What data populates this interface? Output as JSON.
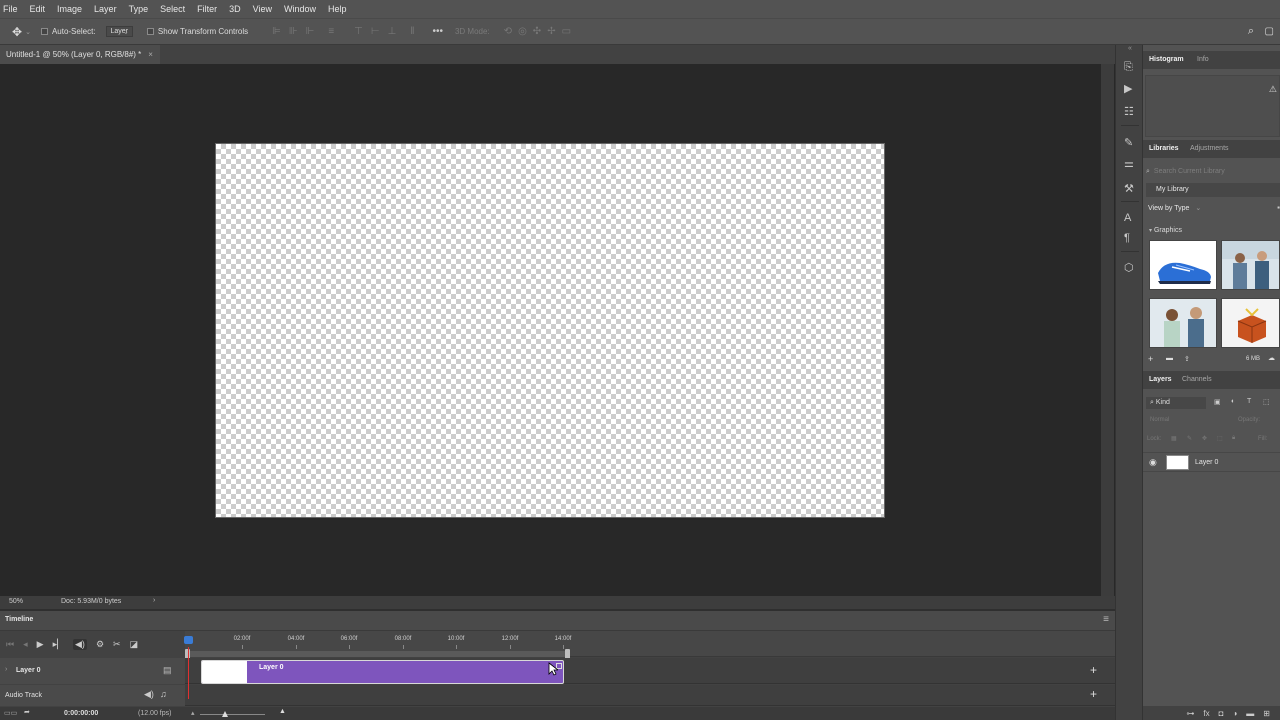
{
  "menu": [
    "File",
    "Edit",
    "Image",
    "Layer",
    "Type",
    "Select",
    "Filter",
    "3D",
    "View",
    "Window",
    "Help"
  ],
  "options": {
    "auto_select_label": "Auto-Select:",
    "auto_select_value": "Layer",
    "show_transform_label": "Show Transform Controls",
    "mode_3d_label": "3D Mode:"
  },
  "document": {
    "tab_title": "Untitled-1 @ 50% (Layer 0, RGB/8#) *",
    "close": "×"
  },
  "status": {
    "zoom": "50%",
    "doc_size": "Doc: 5.93M/0 bytes"
  },
  "timeline": {
    "title": "Timeline",
    "ruler": [
      "02:00f",
      "04:00f",
      "06:00f",
      "08:00f",
      "10:00f",
      "12:00f",
      "14:00f"
    ],
    "layer_track": "Layer 0",
    "clip_label": "Layer 0",
    "audio_track": "Audio Track",
    "timecode": "0:00:00:00",
    "fps": "(12.00 fps)"
  },
  "panels": {
    "histogram_tab": "Histogram",
    "info_tab": "Info",
    "libraries_tab": "Libraries",
    "adjustments_tab": "Adjustments",
    "search_placeholder": "Search Current Library",
    "library_name": "My Library",
    "view_by": "View by Type",
    "graphics_label": "Graphics",
    "library_size": "6 MB",
    "layers_tab": "Layers",
    "channels_tab": "Channels",
    "kind_label": "Kind",
    "blend_mode": "Normal",
    "opacity_label": "Opacity:",
    "lock_label": "Lock:",
    "fill_label": "Fill:",
    "layer_name": "Layer 0"
  },
  "colors": {
    "clip": "#7e55bd",
    "playhead": "#3a7cd6",
    "playhead_line": "#e03030"
  }
}
